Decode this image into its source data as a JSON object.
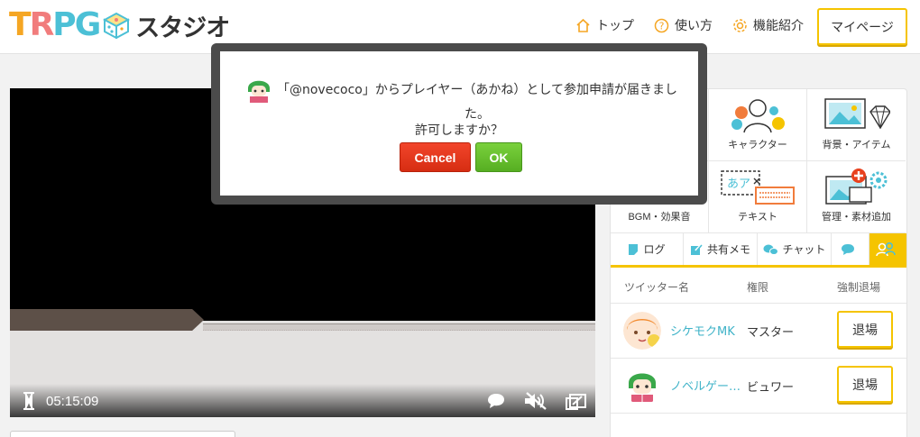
{
  "header": {
    "logo_letters": [
      {
        "ch": "T",
        "color": "#f5a623"
      },
      {
        "ch": "R",
        "color": "#f17c7c"
      },
      {
        "ch": "P",
        "color": "#4cc0d6"
      },
      {
        "ch": "G",
        "color": "#4cc0d6"
      }
    ],
    "logo_text": "スタジオ",
    "nav": [
      {
        "label": "トップ",
        "icon": "home-icon"
      },
      {
        "label": "使い方",
        "icon": "question-icon"
      },
      {
        "label": "機能紹介",
        "icon": "gear-icon"
      }
    ],
    "mypage_label": "マイページ",
    "accent_color": "#f5c400"
  },
  "video": {
    "time": "05:15:09"
  },
  "panel": {
    "tiles": [
      {
        "label": "キャラクター",
        "icon": "character-icon"
      },
      {
        "label": "背景・アイテム",
        "icon": "background-item-icon"
      },
      {
        "label": "BGM・効果音",
        "icon": "bgm-icon"
      },
      {
        "label": "テキスト",
        "icon": "text-icon"
      },
      {
        "label": "管理・素材追加",
        "icon": "manage-add-icon"
      }
    ],
    "tabs": [
      {
        "label": "ログ",
        "icon": "log-icon"
      },
      {
        "label": "共有メモ",
        "icon": "memo-icon"
      },
      {
        "label": "チャット",
        "icon": "chat-icon"
      },
      {
        "label": "",
        "icon": "speech-icon"
      },
      {
        "label": "",
        "icon": "users-icon"
      }
    ],
    "columns": {
      "name": "ツイッター名",
      "role": "権限",
      "kick": "強制退場"
    },
    "users": [
      {
        "name": "シケモクMK",
        "role": "マスター",
        "kick_label": "退場"
      },
      {
        "name": "ノベルゲー…",
        "role": "ビュワー",
        "kick_label": "退場"
      }
    ]
  },
  "dialog": {
    "message_line1": "「@novecoco」からプレイヤー（あかね）として参加申請が届きまし",
    "message_line2": "た。",
    "message_line3": "許可しますか？",
    "cancel_label": "Cancel",
    "ok_label": "OK"
  }
}
